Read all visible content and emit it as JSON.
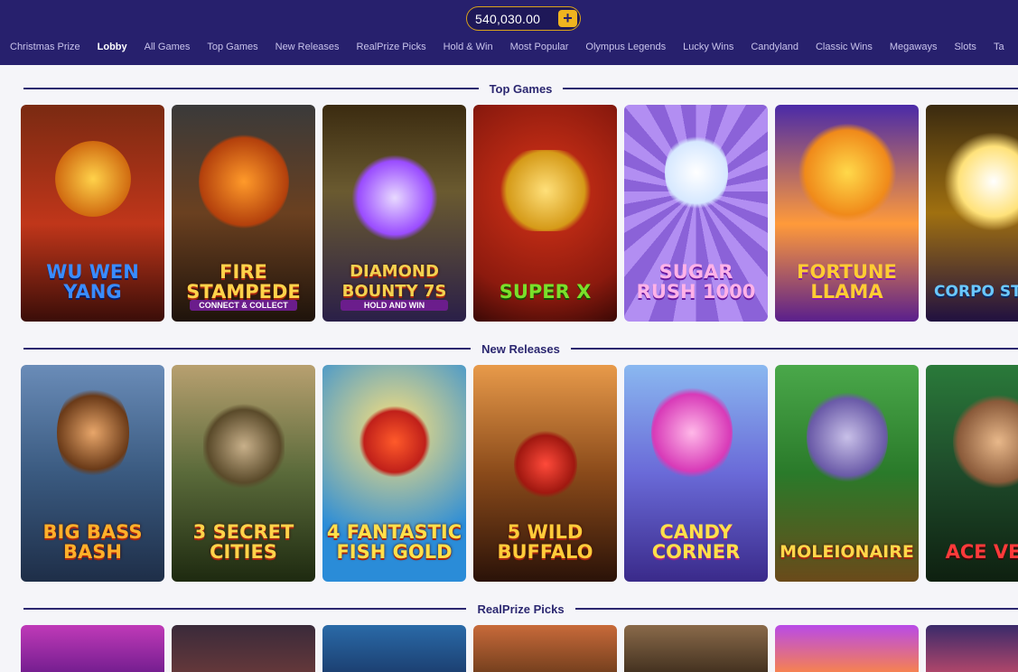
{
  "header": {
    "balance": "540,030.00",
    "add_label": "+"
  },
  "nav": {
    "items": [
      "Christmas Prize",
      "Lobby",
      "All Games",
      "Top Games",
      "New Releases",
      "RealPrize Picks",
      "Hold & Win",
      "Most Popular",
      "Olympus Legends",
      "Lucky Wins",
      "Candyland",
      "Classic Wins",
      "Megaways",
      "Slots",
      "Ta"
    ],
    "active": "Lobby"
  },
  "sections": [
    {
      "title": "Top Games",
      "games": [
        {
          "name": "Wu Wen Yang",
          "sub": ""
        },
        {
          "name": "Fire Stampede",
          "sub": "CONNECT & COLLECT"
        },
        {
          "name": "Diamond Bounty 7s",
          "sub": "HOLD AND WIN"
        },
        {
          "name": "Super X",
          "sub": ""
        },
        {
          "name": "Sugar Rush 1000",
          "sub": ""
        },
        {
          "name": "Fortune Llama",
          "sub": ""
        },
        {
          "name": "Corpo Strike",
          "sub": ""
        }
      ]
    },
    {
      "title": "New Releases",
      "games": [
        {
          "name": "Big Bass Bash",
          "sub": ""
        },
        {
          "name": "3 Secret Cities",
          "sub": ""
        },
        {
          "name": "4 Fantastic Fish Gold",
          "sub": ""
        },
        {
          "name": "5 Wild Buffalo",
          "sub": ""
        },
        {
          "name": "Candy Corner",
          "sub": ""
        },
        {
          "name": "Moleionaire",
          "sub": ""
        },
        {
          "name": "Ace Vent",
          "sub": ""
        }
      ]
    },
    {
      "title": "RealPrize Picks",
      "games": []
    }
  ],
  "colors": {
    "header_bg": "#27206d",
    "accent_gold": "#f0b41f",
    "section_title": "#2b2770"
  }
}
